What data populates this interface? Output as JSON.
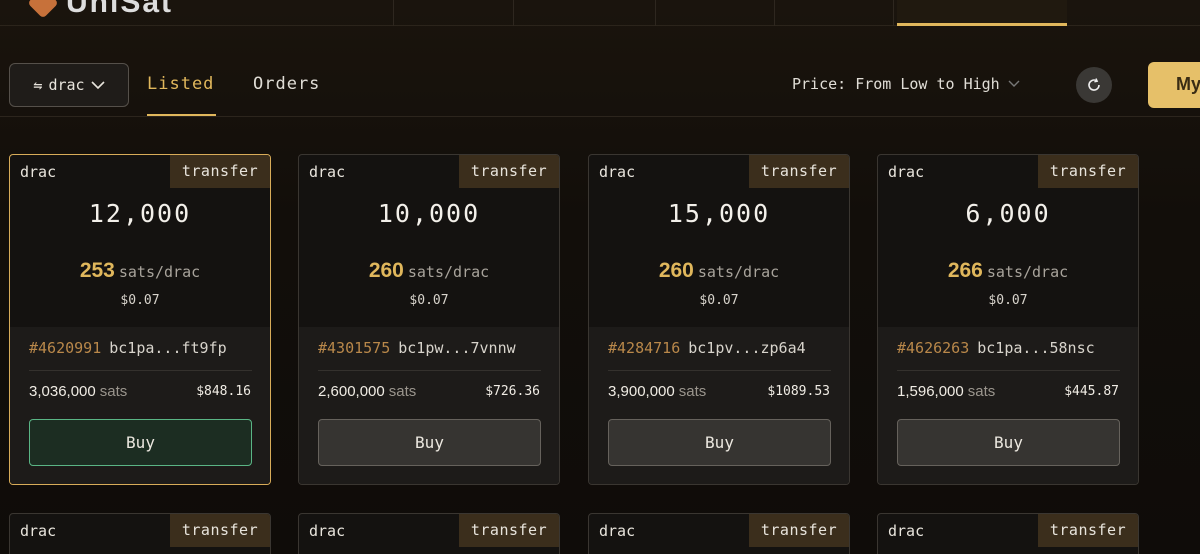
{
  "header": {
    "logo_text": "UniSat"
  },
  "toolbar": {
    "ticker_label": "drac",
    "tabs": [
      {
        "label": "Listed",
        "active": true
      },
      {
        "label": "Orders",
        "active": false
      }
    ],
    "sort_label": "Price: From Low to High",
    "my_button_label": "My"
  },
  "listings": [
    {
      "ticker": "drac",
      "tag": "transfer",
      "amount": "12,000",
      "unit_price": "253",
      "unit": "sats/drac",
      "unit_usd": "$0.07",
      "inscription": "#4620991",
      "address": "bc1pa...ft9fp",
      "total_sats": "3,036,000",
      "sats_label": "sats",
      "total_usd": "$848.16",
      "buy_label": "Buy"
    },
    {
      "ticker": "drac",
      "tag": "transfer",
      "amount": "10,000",
      "unit_price": "260",
      "unit": "sats/drac",
      "unit_usd": "$0.07",
      "inscription": "#4301575",
      "address": "bc1pw...7vnnw",
      "total_sats": "2,600,000",
      "sats_label": "sats",
      "total_usd": "$726.36",
      "buy_label": "Buy"
    },
    {
      "ticker": "drac",
      "tag": "transfer",
      "amount": "15,000",
      "unit_price": "260",
      "unit": "sats/drac",
      "unit_usd": "$0.07",
      "inscription": "#4284716",
      "address": "bc1pv...zp6a4",
      "total_sats": "3,900,000",
      "sats_label": "sats",
      "total_usd": "$1089.53",
      "buy_label": "Buy"
    },
    {
      "ticker": "drac",
      "tag": "transfer",
      "amount": "6,000",
      "unit_price": "266",
      "unit": "sats/drac",
      "unit_usd": "$0.07",
      "inscription": "#4626263",
      "address": "bc1pa...58nsc",
      "total_sats": "1,596,000",
      "sats_label": "sats",
      "total_usd": "$445.87",
      "buy_label": "Buy"
    }
  ],
  "listings_row2": [
    {
      "ticker": "drac",
      "tag": "transfer"
    },
    {
      "ticker": "drac",
      "tag": "transfer"
    },
    {
      "ticker": "drac",
      "tag": "transfer"
    },
    {
      "ticker": "drac",
      "tag": "transfer"
    }
  ],
  "icons": {
    "swap": "swap-arrows-icon",
    "chevron": "chevron-down-icon",
    "refresh": "refresh-icon"
  },
  "colors": {
    "accent": "#e0b75c",
    "tag_bg": "#3b2e1c",
    "selected_buy_border": "#5ab585"
  }
}
